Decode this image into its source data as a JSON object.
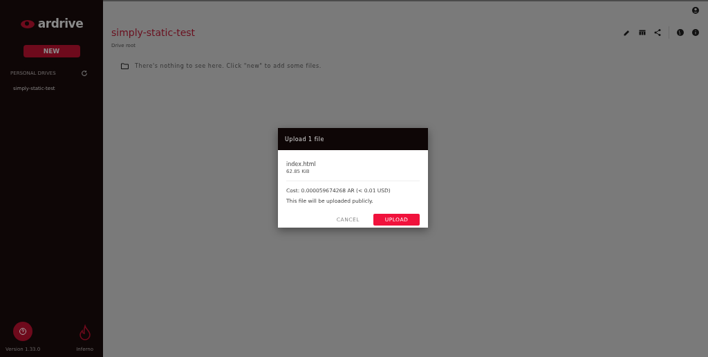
{
  "sidebar": {
    "logo": "ardrive",
    "new_button": "NEW",
    "section_title": "PERSONAL DRIVES",
    "drives": [
      {
        "name": "simply-static-test"
      }
    ],
    "version": "Version 1.33.0",
    "inferno_label": "Inferno"
  },
  "main": {
    "drive_title": "simply-static-test",
    "breadcrumb": "Drive root",
    "empty_message": "There's nothing to see here. Click \"new\" to add some files."
  },
  "dialog": {
    "title": "Upload 1 file",
    "file_name": "index.html",
    "file_size": "62.85 KiB",
    "cost": "Cost: 0.000059674268 AR (< 0.01 USD)",
    "note": "This file will be uploaded publicly.",
    "buttons": [
      {
        "label": "CANCEL",
        "kind": "text"
      },
      {
        "label": "UPLOAD",
        "kind": "primary"
      }
    ]
  }
}
